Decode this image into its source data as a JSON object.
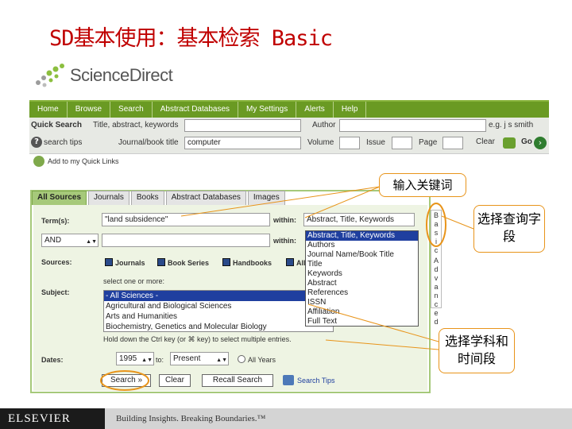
{
  "slide": {
    "title": "SD基本使用：基本检索 Basic"
  },
  "logo": {
    "text": "ScienceDirect"
  },
  "nav": {
    "items": [
      "Home",
      "Browse",
      "Search",
      "Abstract Databases",
      "My Settings",
      "Alerts",
      "Help"
    ]
  },
  "quick_search": {
    "label": "Quick Search",
    "field1_label": "Title, abstract, keywords",
    "field1_value": "",
    "author_label": "Author",
    "author_value": "",
    "author_example": "e.g. j s smith",
    "search_tips": "search tips",
    "journal_label": "Journal/book title",
    "journal_value": "computer",
    "volume_label": "Volume",
    "issue_label": "Issue",
    "page_label": "Page",
    "clear_label": "Clear",
    "go_label": "Go"
  },
  "add_quick_links": "Add to my Quick Links",
  "tabs": [
    "All Sources",
    "Journals",
    "Books",
    "Abstract Databases",
    "Images"
  ],
  "form": {
    "terms_label": "Term(s):",
    "term1_value": "\"land subsidence\"",
    "within_label": "within:",
    "within1_value": "Abstract, Title, Keywords",
    "operator_value": "AND",
    "within2_label": "within:",
    "sources_label": "Sources:",
    "sources": [
      "Journals",
      "Book Series",
      "Handbooks",
      "All"
    ],
    "select_hint": "select one or more:",
    "subjects_label": "Subject:",
    "subjects": [
      "- All Sciences -",
      "Agricultural and Biological Sciences",
      "Arts and Humanities",
      "Biochemistry, Genetics and Molecular Biology"
    ],
    "ctrl_hint": "Hold down the Ctrl key (or ⌘ key) to select multiple entries.",
    "dates_label": "Dates:",
    "date_from": "1995",
    "date_to_label": "to:",
    "date_to": "Present",
    "all_years": "All Years",
    "search_button": "Search »",
    "clear_button": "Clear",
    "recall_button": "Recall Search",
    "search_tips": "Search Tips"
  },
  "field_dropdown": [
    "Abstract, Title, Keywords",
    "Authors",
    "Journal Name/Book Title",
    "Title",
    "Keywords",
    "Abstract",
    "References",
    "ISSN",
    "Affiliation",
    "Full Text"
  ],
  "vertical_tab": {
    "basic": [
      "B",
      "a",
      "s",
      "i",
      "c"
    ],
    "advanced": [
      "A",
      "d",
      "v",
      "a",
      "n",
      "c",
      "e",
      "d"
    ]
  },
  "callouts": {
    "keywords": "输入关键词",
    "fields": "选择查询字段",
    "subject_time": "选择学科和时间段"
  },
  "footer": {
    "logo": "ELSEVIER",
    "tagline": "Building Insights. Breaking Boundaries.™"
  },
  "colors": {
    "title": "#c00000",
    "nav_green": "#6a9a23",
    "callout_border": "#e8941a"
  }
}
